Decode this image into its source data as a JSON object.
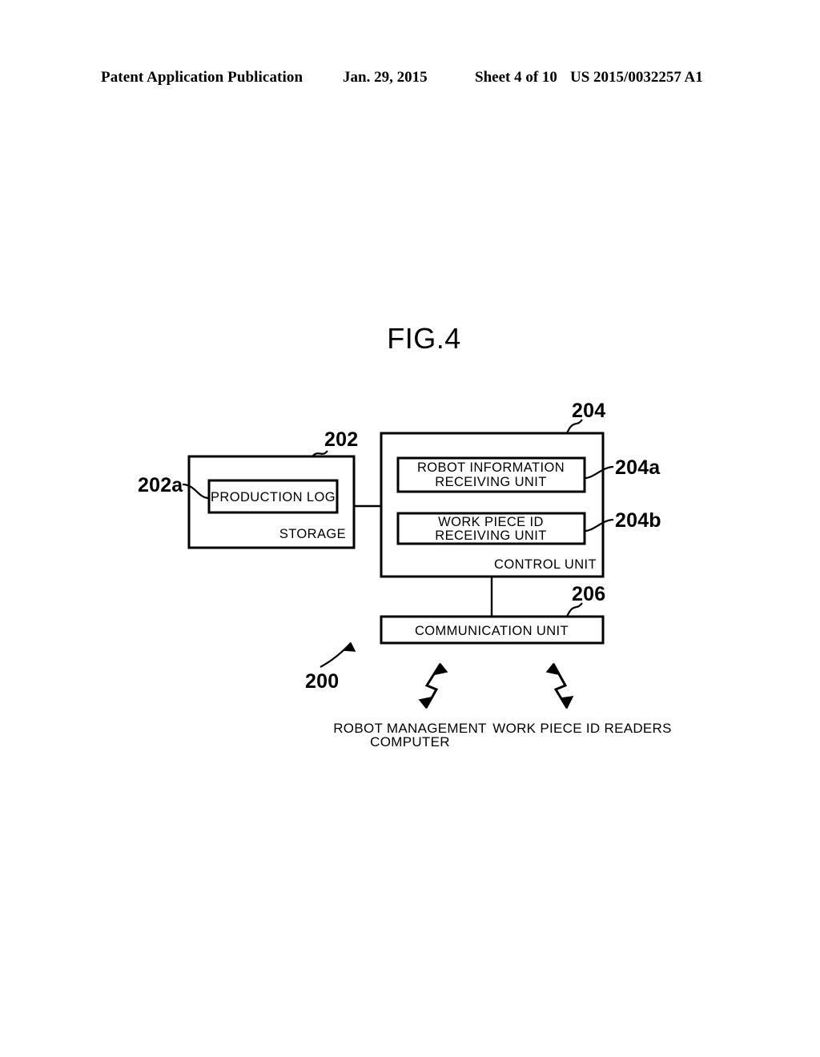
{
  "header": {
    "publication": "Patent Application Publication",
    "date": "Jan. 29, 2015",
    "sheet": "Sheet 4 of 10",
    "publication_number": "US 2015/0032257 A1"
  },
  "figure": {
    "title": "FIG.4",
    "system_ref": "200",
    "blocks": {
      "storage": {
        "label": "STORAGE",
        "ref": "202",
        "inner": {
          "label": "PRODUCTION LOG",
          "ref": "202a"
        }
      },
      "control_unit": {
        "label": "CONTROL UNIT",
        "ref": "204",
        "inner_1": {
          "label_line_1": "ROBOT INFORMATION",
          "label_line_2": "RECEIVING UNIT",
          "ref": "204a"
        },
        "inner_2": {
          "label_line_1": "WORK PIECE ID",
          "label_line_2": "RECEIVING UNIT",
          "ref": "204b"
        }
      },
      "communication_unit": {
        "label": "COMMUNICATION UNIT",
        "ref": "206"
      }
    },
    "external_entities": [
      {
        "label_line_1": "ROBOT MANAGEMENT",
        "label_line_2": "COMPUTER",
        "link": "bidirectional-wireless"
      },
      {
        "label_line_1": "WORK PIECE ID READERS",
        "label_line_2": "",
        "link": "bidirectional-wireless"
      }
    ]
  },
  "colors": {
    "ink": "#000000",
    "paper": "#ffffff"
  }
}
